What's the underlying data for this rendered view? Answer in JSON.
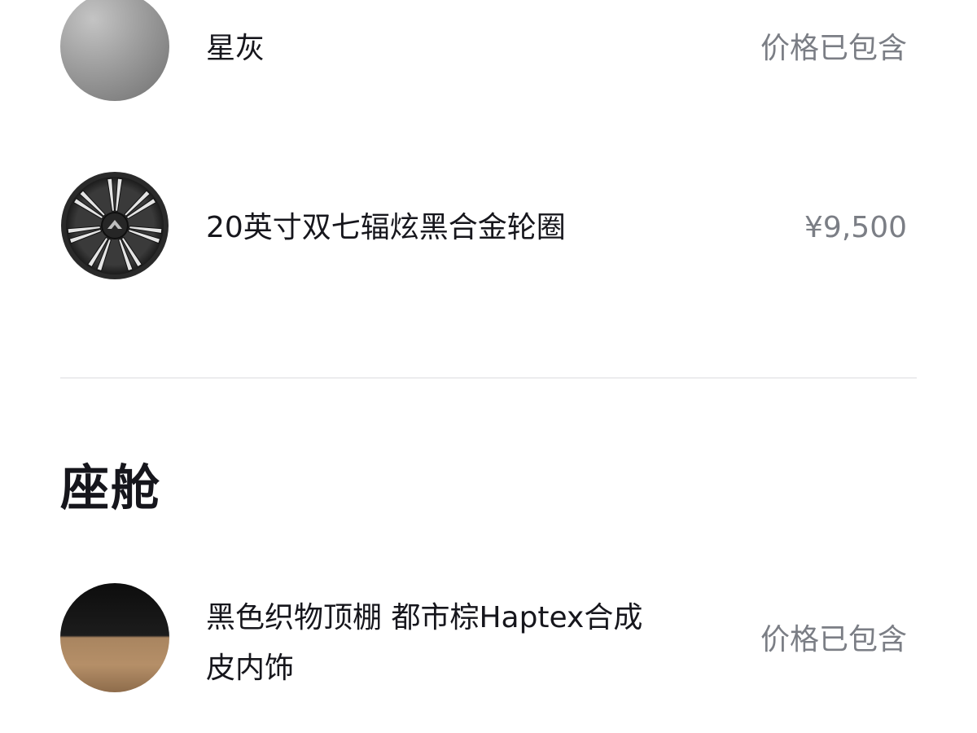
{
  "exterior": {
    "paint": {
      "name": "星灰",
      "price": "价格已包含",
      "swatch_color": "#9d9d9d"
    },
    "wheel": {
      "name": "20英寸双七辐炫黑合金轮圈",
      "price": "¥9,500"
    }
  },
  "cabin": {
    "title": "座舱",
    "interior": {
      "name": "黑色织物顶棚 都市棕Haptex合成皮内饰",
      "price": "价格已包含",
      "top_color": "#111111",
      "bottom_color": "#b08a63"
    }
  }
}
